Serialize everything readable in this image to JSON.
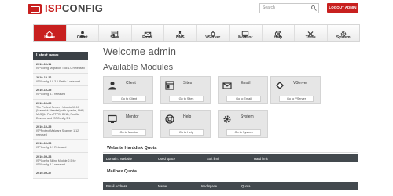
{
  "header": {
    "logo_prefix": "ISP",
    "logo_suffix": "CONFIG",
    "search_placeholder": "Search",
    "logout_label": "LOGOUT ADMIN"
  },
  "nav": [
    {
      "label": "Home",
      "icon": "home-icon",
      "active": true
    },
    {
      "label": "Client",
      "icon": "user-icon",
      "active": false
    },
    {
      "label": "Sites",
      "icon": "sites-icon",
      "active": false
    },
    {
      "label": "Email",
      "icon": "email-icon",
      "active": false
    },
    {
      "label": "DNS",
      "icon": "dns-icon",
      "active": false
    },
    {
      "label": "VServer",
      "icon": "vserver-icon",
      "active": false
    },
    {
      "label": "Monitor",
      "icon": "monitor-icon",
      "active": false
    },
    {
      "label": "Help",
      "icon": "help-icon",
      "active": false
    },
    {
      "label": "Tools",
      "icon": "tools-icon",
      "active": false
    },
    {
      "label": "System",
      "icon": "gear-icon",
      "active": false
    }
  ],
  "sidebar": {
    "heading": "Latest news",
    "news": [
      {
        "date": "2010-10-11",
        "title": "ISPConfig Migration Tool 1.0 Released"
      },
      {
        "date": "2010-10-26",
        "title": "ISPConfig 3.0.3.1 Patch 1 released"
      },
      {
        "date": "2010-10-25",
        "title": "ISPConfig 3.1 released"
      },
      {
        "date": "2010-10-25",
        "title": "The Perfect Server - Ubuntu 10.10 (Maverick Meerkat) with Apache, PHP, MySQL, PureFTPD, BIND, Postfix, Dovecot and ISPConfig 3.1"
      },
      {
        "date": "2010-10-25",
        "title": "ISPProtect Malware Scanner 1.12 released"
      },
      {
        "date": "2010-10-03",
        "title": "ISPConfig 3.1 Released"
      },
      {
        "date": "2010-09-28",
        "title": "ISPConfig Billing Module 2.5 for ISPConfig 3.1 released"
      },
      {
        "date": "2010-09-27",
        "title": ""
      }
    ]
  },
  "main": {
    "welcome": "Welcome admin",
    "available_modules": "Available Modules",
    "modules": [
      {
        "name": "Client",
        "button": "Go to Client",
        "icon": "user-icon"
      },
      {
        "name": "Sites",
        "button": "Go to Sites",
        "icon": "sites-icon"
      },
      {
        "name": "Email",
        "button": "Go to Email",
        "icon": "email-icon"
      },
      {
        "name": "VServer",
        "button": "Go to VServer",
        "icon": "vserver-icon"
      },
      {
        "name": "Monitor",
        "button": "Go to Monitor",
        "icon": "monitor-icon"
      },
      {
        "name": "Help",
        "button": "Go to Help",
        "icon": "help-icon"
      },
      {
        "name": "System",
        "button": "Go to System",
        "icon": "gear-icon"
      }
    ],
    "harddisk_quota": {
      "title": "Website Harddisk Quota",
      "columns": [
        "Domain / Website",
        "Used space",
        "Soft limit",
        "Hard limit"
      ]
    },
    "mailbox_quota": {
      "title": "Mailbox Quota",
      "columns": [
        "Email Address",
        "Name",
        "Used space",
        "Quota"
      ]
    }
  },
  "colors": {
    "brand_red": "#c8201f",
    "dark_header": "#43494e"
  }
}
